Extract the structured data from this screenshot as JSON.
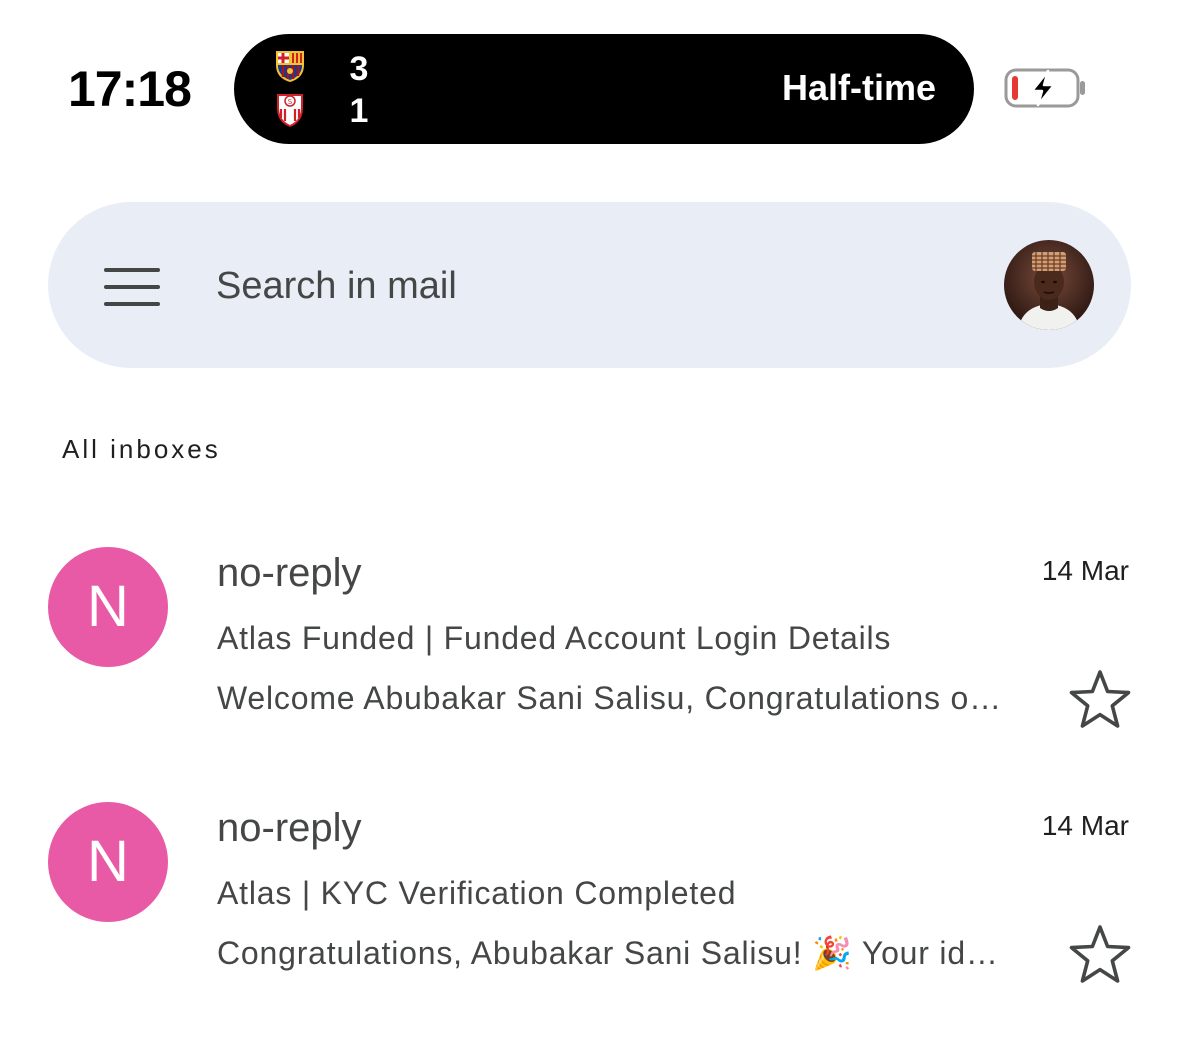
{
  "status_bar": {
    "time": "17:18",
    "live_activity": {
      "home_score": "3",
      "away_score": "1",
      "status": "Half-time",
      "home_crest_icon": "fc-barcelona-crest-icon",
      "away_crest_icon": "sevilla-fc-crest-icon"
    },
    "battery_icon": "battery-low-charging-icon",
    "battery_color": "#e53935"
  },
  "search": {
    "placeholder": "Search in mail",
    "menu_icon": "hamburger-menu-icon",
    "avatar_icon": "profile-photo-avatar"
  },
  "section": {
    "label": "All inboxes"
  },
  "emails": [
    {
      "initial": "N",
      "sender": "no-reply",
      "date": "14 Mar",
      "subject": "Atlas Funded | Funded Account Login Details",
      "snippet": "Welcome Abubakar Sani Salisu, Congratulations o…",
      "avatar_color": "#e85aa5",
      "starred": false
    },
    {
      "initial": "N",
      "sender": "no-reply",
      "date": "14 Mar",
      "subject": "Atlas | KYC Verification Completed",
      "snippet": "Congratulations, Abubakar Sani Salisu! 🎉 Your id…",
      "avatar_color": "#e85aa5",
      "starred": false
    }
  ]
}
